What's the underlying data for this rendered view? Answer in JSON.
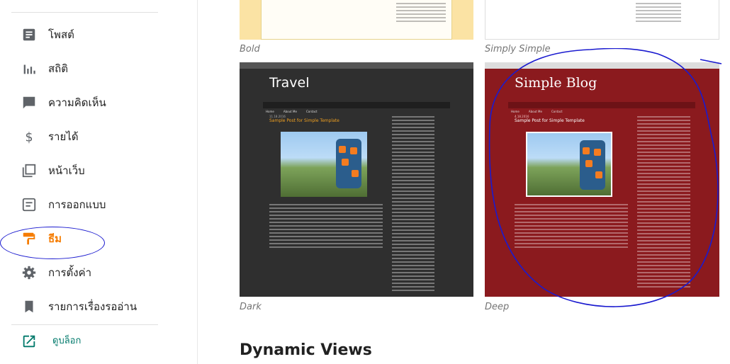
{
  "sidebar": {
    "items": [
      {
        "label": "โพสต์",
        "icon": "posts-icon"
      },
      {
        "label": "สถิติ",
        "icon": "stats-icon"
      },
      {
        "label": "ความคิดเห็น",
        "icon": "comments-icon"
      },
      {
        "label": "รายได้",
        "icon": "dollar-icon"
      },
      {
        "label": "หน้าเว็บ",
        "icon": "pages-icon"
      },
      {
        "label": "การออกแบบ",
        "icon": "layout-icon"
      },
      {
        "label": "ธีม",
        "icon": "paint-roller-icon",
        "active": true
      },
      {
        "label": "การตั้งค่า",
        "icon": "gear-icon"
      },
      {
        "label": "รายการเรื่องรออ่าน",
        "icon": "bookmark-icon"
      }
    ],
    "view_blog": {
      "label": "ดูบล็อก",
      "icon": "external-link-icon"
    }
  },
  "themes": {
    "row1": [
      {
        "name": "Bold"
      },
      {
        "name": "Simply Simple"
      }
    ],
    "row2": [
      {
        "name": "Dark",
        "preview": {
          "blog_title": "Travel",
          "nav": [
            "Home",
            "About Me",
            "Contact"
          ],
          "post_title": "Sample Post for Simple Template",
          "date": "11.18.2016"
        }
      },
      {
        "name": "Deep",
        "preview": {
          "blog_title": "Simple Blog",
          "nav": [
            "Home",
            "About Me",
            "Contact"
          ],
          "post_title": "Sample Post for Simple Template",
          "date": "4.18.2016"
        }
      }
    ]
  },
  "section_heading": "Dynamic Views",
  "colors": {
    "accent": "#f57c00",
    "view_blog": "#00796b",
    "annotation": "#1a1acf"
  }
}
